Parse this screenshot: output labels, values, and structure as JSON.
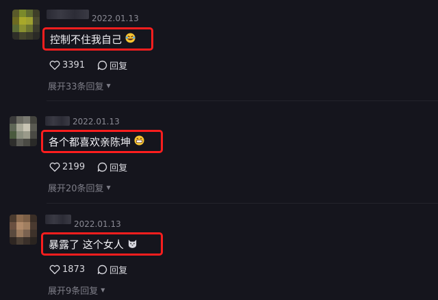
{
  "comments": [
    {
      "date": "2022.01.13",
      "text": "控制不住我自己",
      "emoji_icon": "rofl-emoji",
      "likes": "3391",
      "reply_label": "回复",
      "expand_label": "展开33条回复"
    },
    {
      "date": "2022.01.13",
      "text": "各个都喜欢亲陈坤",
      "emoji_icon": "grin-emoji",
      "likes": "2199",
      "reply_label": "回复",
      "expand_label": "展开20条回复"
    },
    {
      "date": "2022.01.13",
      "text": "暴露了 这个女人",
      "emoji_icon": "cat-emoji",
      "likes": "1873",
      "reply_label": "回复",
      "expand_label": "展开9条回复"
    }
  ],
  "colors": {
    "background": "#15151d",
    "highlight_border": "#ff1e1e",
    "muted_text": "#7e7e88"
  }
}
